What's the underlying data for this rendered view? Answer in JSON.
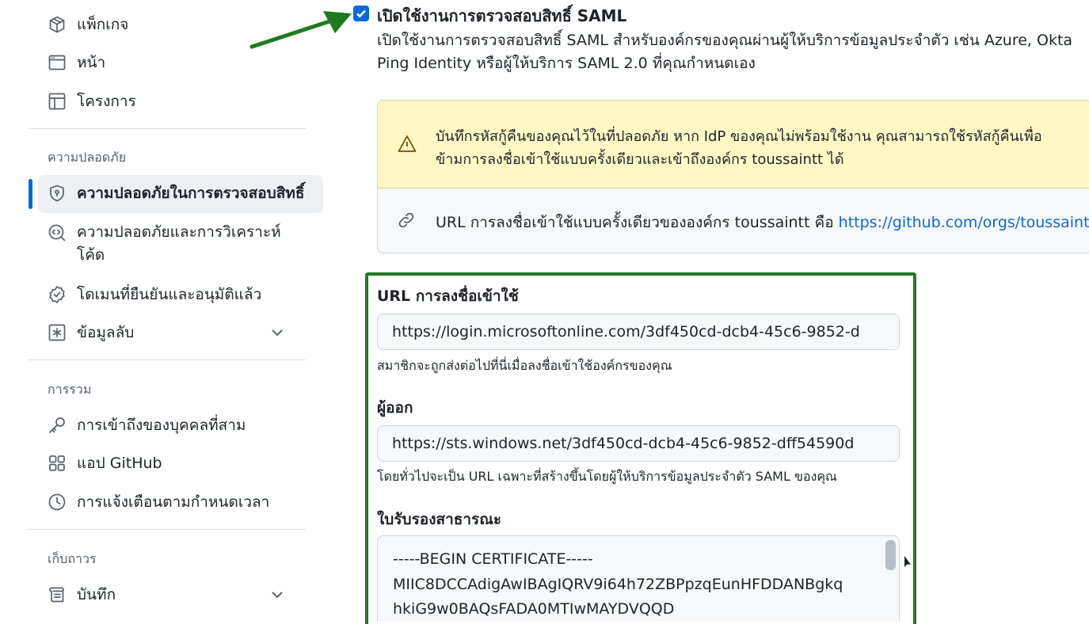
{
  "sidebar": {
    "top_items": [
      {
        "label": "แพ็กเกจ",
        "icon": "package-icon"
      },
      {
        "label": "หน้า",
        "icon": "browser-icon"
      },
      {
        "label": "โครงการ",
        "icon": "table-icon"
      }
    ],
    "security_section_title": "ความปลอดภัย",
    "security_items": [
      {
        "label": "ความปลอดภัยในการตรวจสอบสิทธิ์",
        "icon": "shield-lock-icon"
      },
      {
        "label_line1": "ความปลอดภัยและการวิเคราะห์",
        "label_line2": "โค้ด",
        "icon": "codescan-icon"
      },
      {
        "label": "โดเมนที่ยืนยันและอนุมัติแล้ว",
        "icon": "verified-icon"
      },
      {
        "label": "ข้อมูลลับ",
        "icon": "key-asterisk-icon"
      }
    ],
    "integrations_section_title": "การรวม",
    "integrations_items": [
      {
        "label": "การเข้าถึงของบุคคลที่สาม",
        "icon": "key-icon"
      },
      {
        "label": "แอป GitHub",
        "icon": "apps-icon"
      },
      {
        "label": "การแจ้งเตือนตามกำหนดเวลา",
        "icon": "clock-icon"
      }
    ],
    "archive_section_title": "เก็บถาวร",
    "archive_items": [
      {
        "label": "บันทึก",
        "icon": "log-icon"
      }
    ]
  },
  "saml": {
    "enabled": true,
    "title": "เปิดใช้งานการตรวจสอบสิทธิ์ SAML",
    "desc_line1": "เปิดใช้งานการตรวจสอบสิทธิ์ SAML สำหรับองค์กรของคุณผ่านผู้ให้บริการข้อมูลประจำตัว เช่น Azure, Okta",
    "desc_line2": "Ping Identity หรือผู้ให้บริการ SAML 2.0 ที่คุณกำหนดเอง"
  },
  "warning": {
    "line1": "บันทึกรหัสกู้คืนของคุณไว้ในที่ปลอดภัย หาก IdP ของคุณไม่พร้อมใช้งาน คุณสามารถใช้รหัสกู้คืนเพื่อ",
    "line2": "ข้ามการลงชื่อเข้าใช้แบบครั้งเดียวและเข้าถึงองค์กร toussaintt ได้"
  },
  "sso_link": {
    "prefix": "URL การลงชื่อเข้าใช้แบบครั้งเดียวขององค์กร toussaintt คือ ",
    "url": "https://github.com/orgs/toussaintt"
  },
  "form": {
    "signon_label": "URL การลงชื่อเข้าใช้",
    "signon_value": "https://login.microsoftonline.com/3df450cd-dcb4-45c6-9852-d",
    "signon_note": "สมาชิกจะถูกส่งต่อไปที่นี่เมื่อลงชื่อเข้าใช้องค์กรของคุณ",
    "issuer_label": "ผู้ออก",
    "issuer_value": "https://sts.windows.net/3df450cd-dcb4-45c6-9852-dff54590d",
    "issuer_note": "โดยทั่วไปจะเป็น URL เฉพาะที่สร้างขึ้นโดยผู้ให้บริการข้อมูลประจำตัว SAML ของคุณ",
    "cert_label": "ใบรับรองสาธารณะ",
    "cert_lines": [
      "-----BEGIN CERTIFICATE-----",
      "MIIC8DCCAdigAwIBAgIQRV9i64h72ZBPpzqEunHFDDANBgkq",
      "hkiG9w0BAQsFADA0MTIwMAYDVQQD"
    ]
  },
  "colors": {
    "accent": "#0969da",
    "highlight_green": "#1f7a1f",
    "warning_bg": "#fff8c5"
  }
}
